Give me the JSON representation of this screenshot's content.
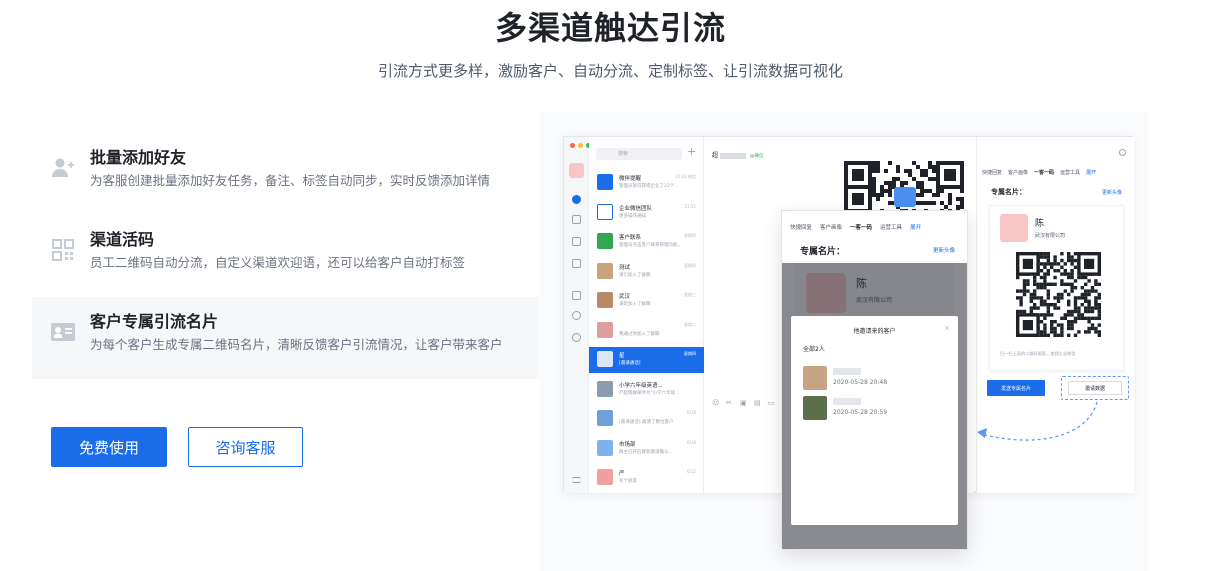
{
  "header": {
    "title": "多渠道触达引流",
    "subtitle": "引流方式更多样，激励客户、自动分流、定制标签、让引流数据可视化"
  },
  "features": [
    {
      "icon": "add-user-icon",
      "title": "批量添加好友",
      "desc": "为客服创建批量添加好友任务，备注、标签自动同步，实时反馈添加详情",
      "active": false
    },
    {
      "icon": "qr-code-icon",
      "title": "渠道活码",
      "desc": "员工二维码自动分流，自定义渠道欢迎语，还可以给客户自动打标签",
      "active": false
    },
    {
      "icon": "contact-card-icon",
      "title": "客户专属引流名片",
      "desc": "为每个客户生成专属二维码名片，清晰反馈客户引流情况，让客户带来客户",
      "active": true
    }
  ],
  "buttons": {
    "primary": "免费使用",
    "secondary": "咨询客服"
  },
  "illustration": {
    "search_placeholder": "搜索",
    "conversations": [
      {
        "name": "微伴提醒",
        "msg": "管理员即可获得企业了22个...",
        "time": "21:23 微信",
        "color": "#1a6ce8"
      },
      {
        "name": "企业微信团队",
        "msg": "更多操作通知",
        "time": "21:51",
        "color": "#ffffff"
      },
      {
        "name": "客户联系",
        "msg": "管理员点击客户联系管理功能...",
        "time": "星期四",
        "color": "#2fa84f"
      },
      {
        "name": "测试",
        "msg": "请们加入了群聊",
        "time": "星期四",
        "color": "#c9a27e"
      },
      {
        "name": "武汉",
        "msg": "满足加入了群聊",
        "time": "星期三",
        "color": "#b98a6a"
      },
      {
        "name": "",
        "msg": "我通过你加入了群聊",
        "time": "星期二",
        "color": "#e09d9d"
      },
      {
        "name": "星",
        "msg": "[邀请通话]",
        "time": "星期四",
        "color": "#dbe6f5"
      },
      {
        "name": "小学六年级英语...",
        "msg": "严超我群邮件为\"小学六年级...",
        "time": "",
        "color": "#8d9bb0"
      },
      {
        "name": "",
        "msg": "[邀请通话] 邀请了数位客户",
        "time": "6/16",
        "color": "#6fa0d8"
      },
      {
        "name": "市场部",
        "msg": "群主已开启群新邀请确认...",
        "time": "6/16",
        "color": "#7fb0f0"
      },
      {
        "name": "严",
        "msg": "有个朋友",
        "time": "6/12",
        "color": "#f0a0a0"
      }
    ],
    "chat_head": "超",
    "chat_tag": "@微信",
    "tabs": [
      "快捷回复",
      "客户画像",
      "一客一码",
      "运营工具",
      "展开"
    ],
    "card_label": "专属名片：",
    "refresh_link": "更新头像",
    "card_name": "陈",
    "card_company": "武汉有限公司",
    "card_note": "扫一扫上面的二维码图案，加我企业微信",
    "send_button": "发送专属名片",
    "invite_button": "邀请数据",
    "modal": {
      "title": "他邀请来的客户",
      "count": "全部2人",
      "rows": [
        {
          "date": "2020-05-28 20:48",
          "color": "#c7a484"
        },
        {
          "date": "2020-05-28 20:59",
          "color": "#5c6f4a"
        }
      ]
    }
  }
}
